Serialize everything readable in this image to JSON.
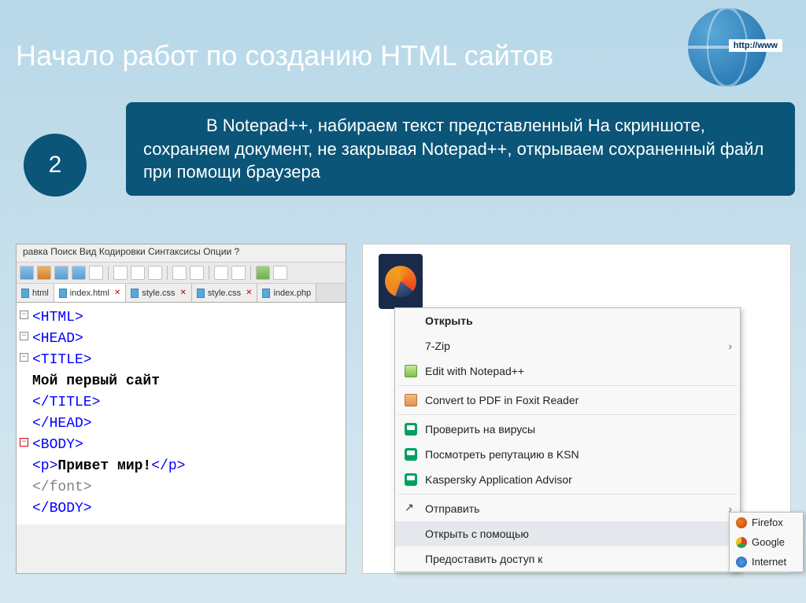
{
  "title": "Начало работ по созданию HTML сайтов",
  "globe_banner": "http://www",
  "step_number": "2",
  "description": "В Notepad++, набираем текст представленный На скриншоте, сохраняем документ, не закрывая Notepad++, открываем сохраненный файл при помощи браузера",
  "npp": {
    "menubar": "равка   Поиск   Вид   Кодировки   Синтаксисы   Опции   ?",
    "tabs": [
      "html",
      "index.html",
      "style.css",
      "style.css",
      "index.php"
    ],
    "code": {
      "l1": "<HTML>",
      "l2": "<HEAD>",
      "l3": "<TITLE>",
      "l4": "Мой первый сайт",
      "l5": "</TITLE>",
      "l6": "</HEAD>",
      "l7": "<BODY>",
      "l8a": "<p>",
      "l8b": "Привет мир!",
      "l8c": "</p>",
      "l9": "</font>",
      "l10": "</BODY>"
    }
  },
  "context_menu": {
    "open": "Открыть",
    "sevenzip": "7-Zip",
    "edit_npp": "Edit with Notepad++",
    "convert_pdf": "Convert to PDF in Foxit Reader",
    "scan": "Проверить на вирусы",
    "ksn": "Посмотреть репутацию в KSN",
    "advisor": "Kaspersky Application Advisor",
    "send": "Отправить",
    "open_with": "Открыть с помощью",
    "share": "Предоставить доступ к"
  },
  "submenu": {
    "firefox": "Firefox",
    "google": "Google",
    "internet": "Internet"
  }
}
